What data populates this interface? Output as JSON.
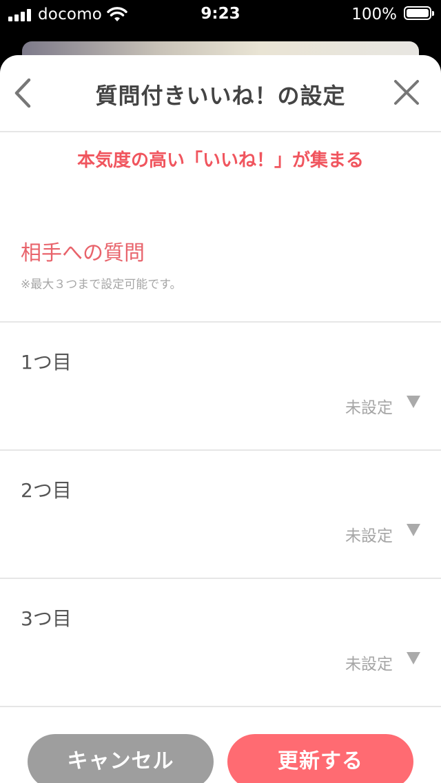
{
  "status_bar": {
    "carrier": "docomo",
    "time": "9:23",
    "battery_percent": "100%",
    "icons": [
      "signal-icon",
      "wifi-icon",
      "battery-icon"
    ]
  },
  "header": {
    "title": "質問付きいいね！の設定",
    "back_icon": "chevron-left-icon",
    "close_icon": "close-icon"
  },
  "tagline": "本気度の高い「いいね！」が集まる",
  "section": {
    "heading": "相手への質問",
    "note": "※最大３つまで設定可能です。"
  },
  "questions": [
    {
      "label": "1つ目",
      "value": "未設定"
    },
    {
      "label": "2つ目",
      "value": "未設定"
    },
    {
      "label": "3つ目",
      "value": "未設定"
    }
  ],
  "buttons": {
    "cancel_label": "キャンセル",
    "update_label": "更新する"
  },
  "colors": {
    "accent": "#ff6b72",
    "tagline": "#f0555e",
    "cancel": "#9e9e9e"
  }
}
